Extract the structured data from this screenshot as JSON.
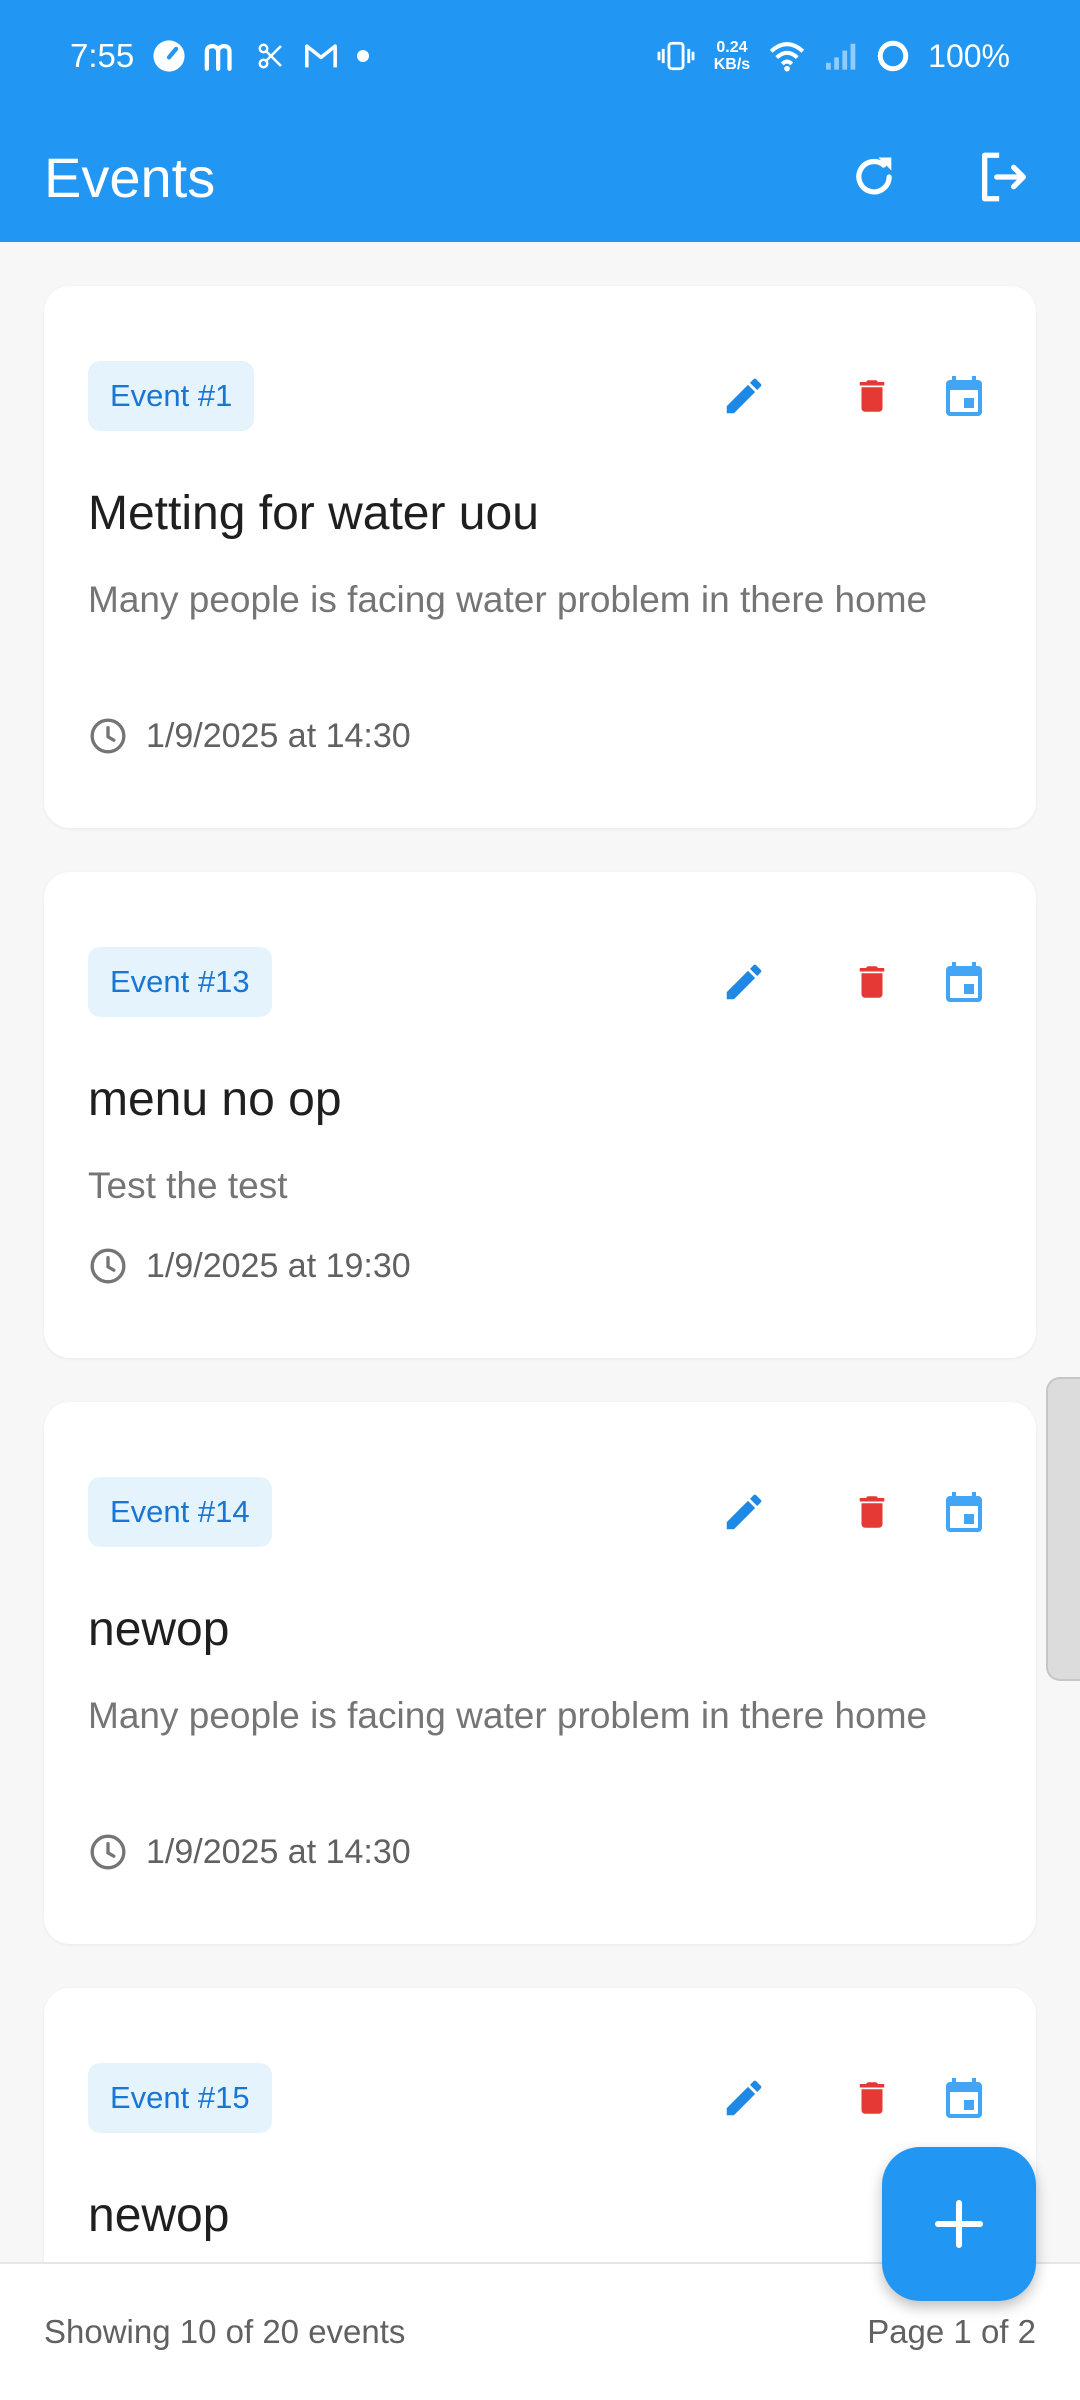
{
  "status_bar": {
    "time": "7:55",
    "net_speed_value": "0.24",
    "net_speed_unit": "KB/s",
    "battery": "100%"
  },
  "app_bar": {
    "title": "Events",
    "refresh_icon": "refresh-icon",
    "logout_icon": "logout-icon"
  },
  "events": [
    {
      "badge": "Event #1",
      "title": "Metting for water uou",
      "description": "Many people is facing water problem in there home",
      "datetime": "1/9/2025 at 14:30"
    },
    {
      "badge": "Event #13",
      "title": "menu no op",
      "description": "Test the test",
      "datetime": "1/9/2025 at 19:30"
    },
    {
      "badge": "Event #14",
      "title": "newop",
      "description": "Many people is facing water problem in there home",
      "datetime": "1/9/2025 at 14:30"
    },
    {
      "badge": "Event #15",
      "title": "newop",
      "description": "",
      "datetime": ""
    }
  ],
  "footer": {
    "showing": "Showing 10 of 20 events",
    "page": "Page 1 of 2"
  },
  "colors": {
    "primary": "#2196f3",
    "edit": "#1e88e5",
    "delete": "#e53935",
    "calendar": "#42a5f5",
    "badge_bg": "#e5f3fd"
  }
}
